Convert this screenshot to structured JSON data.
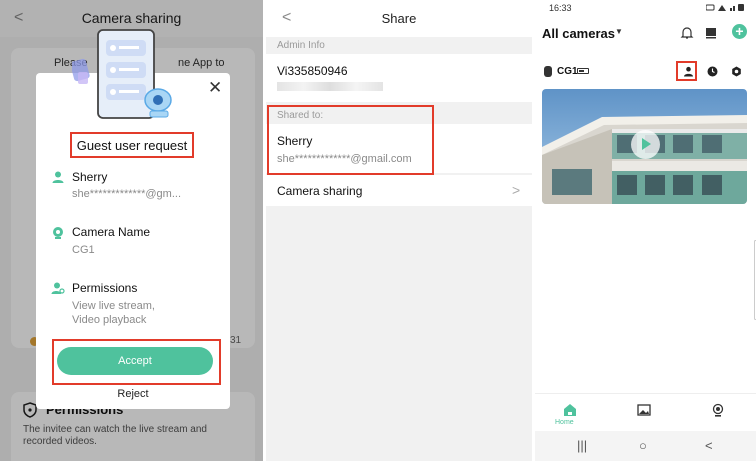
{
  "panel1": {
    "header_title": "Camera sharing",
    "back_glyph": "<",
    "bg_text_left": "Please",
    "bg_text_right": "ne App to",
    "bg_badge_text": "31",
    "permissions_title": "Permissions",
    "permissions_desc": "The invitee can watch the live stream and recorded videos.",
    "modal": {
      "title": "Guest user request",
      "close_glyph": "✕",
      "user_label": "Sherry",
      "user_email": "she*************@gm...",
      "camera_label": "Camera Name",
      "camera_value": "CG1",
      "perm_label": "Permissions",
      "perm_line1": "View live stream,",
      "perm_line2": "Video playback",
      "accept_label": "Accept",
      "reject_label": "Reject"
    }
  },
  "panel2": {
    "header_title": "Share",
    "back_glyph": "<",
    "admin_section": "Admin Info",
    "admin_id": "Vi335850946",
    "shared_section": "Shared to:",
    "shared_name": "Sherry",
    "shared_email": "she*************@gmail.com",
    "camera_sharing_label": "Camera sharing",
    "chevron_glyph": ">"
  },
  "panel3": {
    "status_time": "16:33",
    "title": "All cameras",
    "caret_glyph": "▼",
    "plus_glyph": "+",
    "camera_name": "CG1",
    "tab_home_label": "Home",
    "nav_recent": "|||",
    "nav_home": "○",
    "nav_back": "<"
  },
  "colors": {
    "accent": "#4fc29d",
    "highlight": "#e23b2a"
  }
}
